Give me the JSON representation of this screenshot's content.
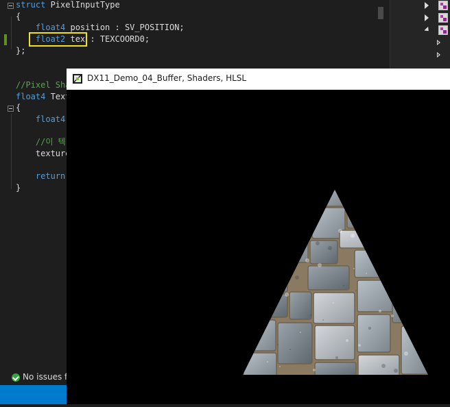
{
  "editor": {
    "lines": [
      {
        "parts": [
          [
            "kw",
            "struct"
          ],
          [
            "id",
            " PixelInputType"
          ]
        ]
      },
      {
        "parts": [
          [
            "op",
            "{"
          ]
        ]
      },
      {
        "parts": []
      },
      {
        "parts": [
          [
            "ty",
            "    float4"
          ],
          [
            "id",
            " position : SV_POSITION;"
          ]
        ]
      },
      {
        "parts": [
          [
            "ty",
            "    float2"
          ],
          [
            "id",
            " tex : TEXCOORD0;"
          ]
        ]
      },
      {
        "parts": [
          [
            "op",
            "};"
          ]
        ]
      },
      {
        "parts": []
      },
      {
        "parts": [
          [
            "cm",
            "//Pixel Sha"
          ]
        ]
      },
      {
        "parts": [
          [
            "ty",
            "float4"
          ],
          [
            "id",
            " Text"
          ]
        ]
      },
      {
        "parts": [
          [
            "op",
            "{"
          ]
        ]
      },
      {
        "parts": [
          [
            "ty",
            "    float4"
          ]
        ]
      },
      {
        "parts": []
      },
      {
        "parts": [
          [
            "cm",
            "    //이 텍"
          ]
        ]
      },
      {
        "parts": [
          [
            "id",
            "    texture"
          ]
        ]
      },
      {
        "parts": []
      },
      {
        "parts": [
          [
            "kw",
            "    return"
          ]
        ]
      },
      {
        "parts": [
          [
            "op",
            "}"
          ]
        ]
      }
    ]
  },
  "status": {
    "text": "No issues fo"
  },
  "window": {
    "title": "DX11_Demo_04_Buffer, Shaders, HLSL"
  },
  "scene": {
    "shape": "triangle",
    "texture": "stone-tile",
    "background": "#000000"
  },
  "colors": {
    "editor_bg": "#1e1e1e",
    "keyword": "#569cd6",
    "comment": "#57a64a",
    "highlight": "#f2e21c",
    "status_blue": "#007acc"
  }
}
